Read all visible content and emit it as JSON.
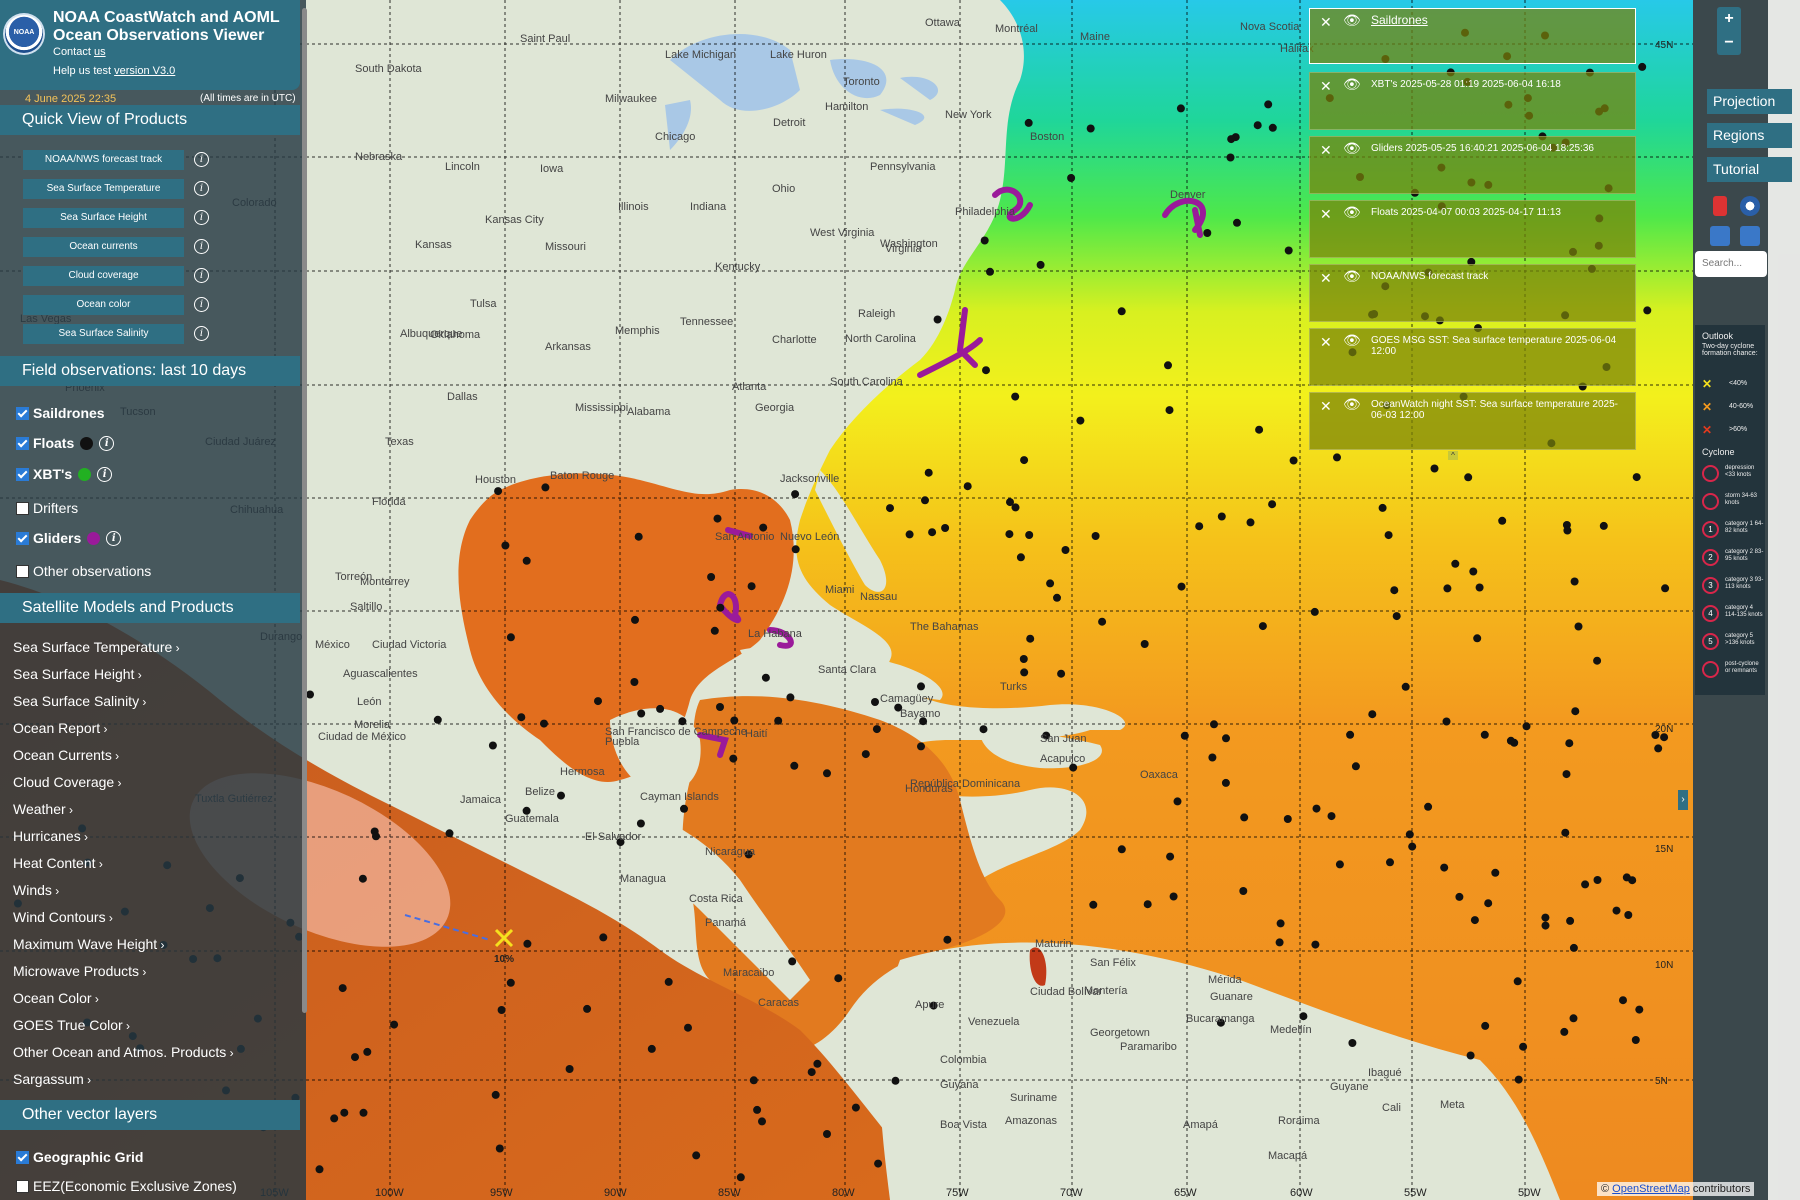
{
  "header": {
    "title_line1": "NOAA CoastWatch and AOML",
    "title_line2": "Ocean Observations Viewer",
    "contact_prefix": "Contact ",
    "contact_link": "us",
    "help_prefix": "Help us test ",
    "help_link": "version V3.0",
    "logo_text": "NOAA",
    "date_stamp": "4 June 2025 22:35",
    "timezone_note": "(All times are in UTC)"
  },
  "quick_view": {
    "heading": "Quick View of Products",
    "items": [
      "NOAA/NWS forecast track",
      "Sea Surface Temperature",
      "Sea Surface Height",
      "Ocean currents",
      "Cloud coverage",
      "Ocean color",
      "Sea Surface Salinity"
    ]
  },
  "field_obs": {
    "heading": "Field observations: last 10 days",
    "items": [
      {
        "label": "Saildrones",
        "checked": true
      },
      {
        "label": "Floats",
        "checked": true,
        "dot": "#111111"
      },
      {
        "label": "XBT's",
        "checked": true,
        "dot": "#22b022"
      },
      {
        "label": "Drifters",
        "checked": false
      },
      {
        "label": "Gliders",
        "checked": true,
        "dot": "#9a1a9a"
      },
      {
        "label": "Other observations",
        "checked": false
      }
    ]
  },
  "satellite": {
    "heading": "Satellite Models and Products",
    "items": [
      "Sea Surface Temperature",
      "Sea Surface Height",
      "Sea Surface Salinity",
      "Ocean Report",
      "Ocean Currents",
      "Cloud Coverage",
      "Weather",
      "Hurricanes",
      "Heat Content",
      "Winds",
      "Wind Contours",
      "Maximum Wave Height",
      "Microwave Products",
      "Ocean Color",
      "GOES True Color",
      "Other Ocean and Atmos. Products",
      "Sargassum"
    ]
  },
  "vector_layers": {
    "heading": "Other vector layers",
    "items": [
      {
        "label": "Geographic Grid",
        "checked": true
      },
      {
        "label": "EEZ(Economic Exclusive Zones)",
        "checked": false
      }
    ]
  },
  "right_panel": {
    "zoom_in": "+",
    "zoom_out": "−",
    "projection": "Projection",
    "regions": "Regions",
    "tutorial": "Tutorial",
    "search_placeholder": "Search...",
    "legend_title": "Outlook",
    "legend_subtitle": "Two-day cyclone formation chance:",
    "outlook": [
      "<40%",
      "40-60%",
      ">60%"
    ],
    "cyclone_title": "Cyclone",
    "cyclone_items": [
      "depression <33 knots",
      "storm 34-63 knots",
      "category 1 64-82 knots",
      "category 2 83-95 knots",
      "category 3 93-113 knots",
      "category 4 114-135 knots",
      "category 5 >136 knots",
      "post-cyclone or remnants"
    ]
  },
  "layers": [
    "Saildrones",
    "XBT's 2025-05-28 01:19 2025-06-04 16:18",
    "Gliders 2025-05-25 16:40:21 2025-06-04 18:25:36",
    "Floats 2025-04-07 00:03 2025-04-17 11:13",
    "NOAA/NWS forecast track",
    "GOES MSG SST: Sea surface temperature 2025-06-04 12:00",
    "OceanWatch night SST: Sea surface temperature 2025-06-03 12:00"
  ],
  "map": {
    "lon_labels": [
      "105W",
      "100W",
      "95W",
      "90W",
      "85W",
      "80W",
      "75W",
      "70W",
      "65W",
      "60W",
      "55W",
      "50W"
    ],
    "lat_labels": [
      "45N",
      "20N",
      "15N",
      "10N",
      "5N"
    ],
    "place_labels": [
      "Saint Paul",
      "Ottawa",
      "Montréal",
      "Nova Scotia",
      "Halifax",
      "Maine",
      "South Dakota",
      "Toronto",
      "Milwaukee",
      "Lake Michigan",
      "Lake Huron",
      "Hamilton",
      "New York",
      "Boston",
      "Detroit",
      "Chicago",
      "Nebraska",
      "Lincoln",
      "Iowa",
      "Ohio",
      "Pennsylvania",
      "Philadelphia",
      "Kansas City",
      "Illinois",
      "Indiana",
      "Washington",
      "Denver",
      "Colorado",
      "Kansas",
      "Missouri",
      "West Virginia",
      "Virginia",
      "Kentucky",
      "Tulsa",
      "Raleigh",
      "Oklahoma",
      "Memphis",
      "Charlotte",
      "North Carolina",
      "Tennessee",
      "Las Vegas",
      "Albuquerque",
      "Arkansas",
      "South Carolina",
      "Phoenix",
      "Tucson",
      "Dallas",
      "Atlanta",
      "Georgia",
      "Mississippi",
      "Alabama",
      "Ciudad Juárez",
      "Texas",
      "Baton Rouge",
      "Jacksonville",
      "Houston",
      "Chihuahua",
      "San Antonio",
      "Florida",
      "Nuevo León",
      "Torreón",
      "Monterrey",
      "Saltillo",
      "Miami",
      "Nassau",
      "The Bahamas",
      "Durango",
      "México",
      "Ciudad Victoria",
      "La Habana",
      "Santa Clara",
      "Aguascalientes",
      "León",
      "Camagüey",
      "Bayamo",
      "Turks",
      "Morelia",
      "Ciudad de México",
      "San Francisco de Campeche",
      "Puebla",
      "Hermosa",
      "Belize",
      "Cayman Islands",
      "Haití",
      "República Dominicana",
      "San Juan",
      "Acapulco",
      "Oaxaca",
      "Tuxtla Gutiérrez",
      "Jamaica",
      "Guatemala",
      "Honduras",
      "El Salvador",
      "Nicaragua",
      "Managua",
      "Costa Rica",
      "Panamá",
      "Maracaibo",
      "Caracas",
      "Maturin",
      "San Félix",
      "Mérida",
      "Guanare",
      "Ciudad Bolívar",
      "Montería",
      "Bucaramanga",
      "Apure",
      "Venezuela",
      "Georgetown",
      "Paramaribo",
      "Medellín",
      "Ibagué",
      "Colombia",
      "Guyana",
      "Suriname",
      "Guyane",
      "Cali",
      "Meta",
      "Boa Vista",
      "Amazonas",
      "Roraima",
      "Amapá",
      "Macapá"
    ],
    "forecast_label": "10%"
  },
  "attribution": {
    "prefix": "© ",
    "link": "OpenStreetMap",
    "suffix": " contributors"
  },
  "colors": {
    "panel": "#2f6f83",
    "sst_warm": "#e06a1a",
    "sst_hot": "#c8501f",
    "sst_yellow": "#f2f21e",
    "sst_green": "#26e07a",
    "glider": "#9a1a9a",
    "float": "#111111"
  }
}
